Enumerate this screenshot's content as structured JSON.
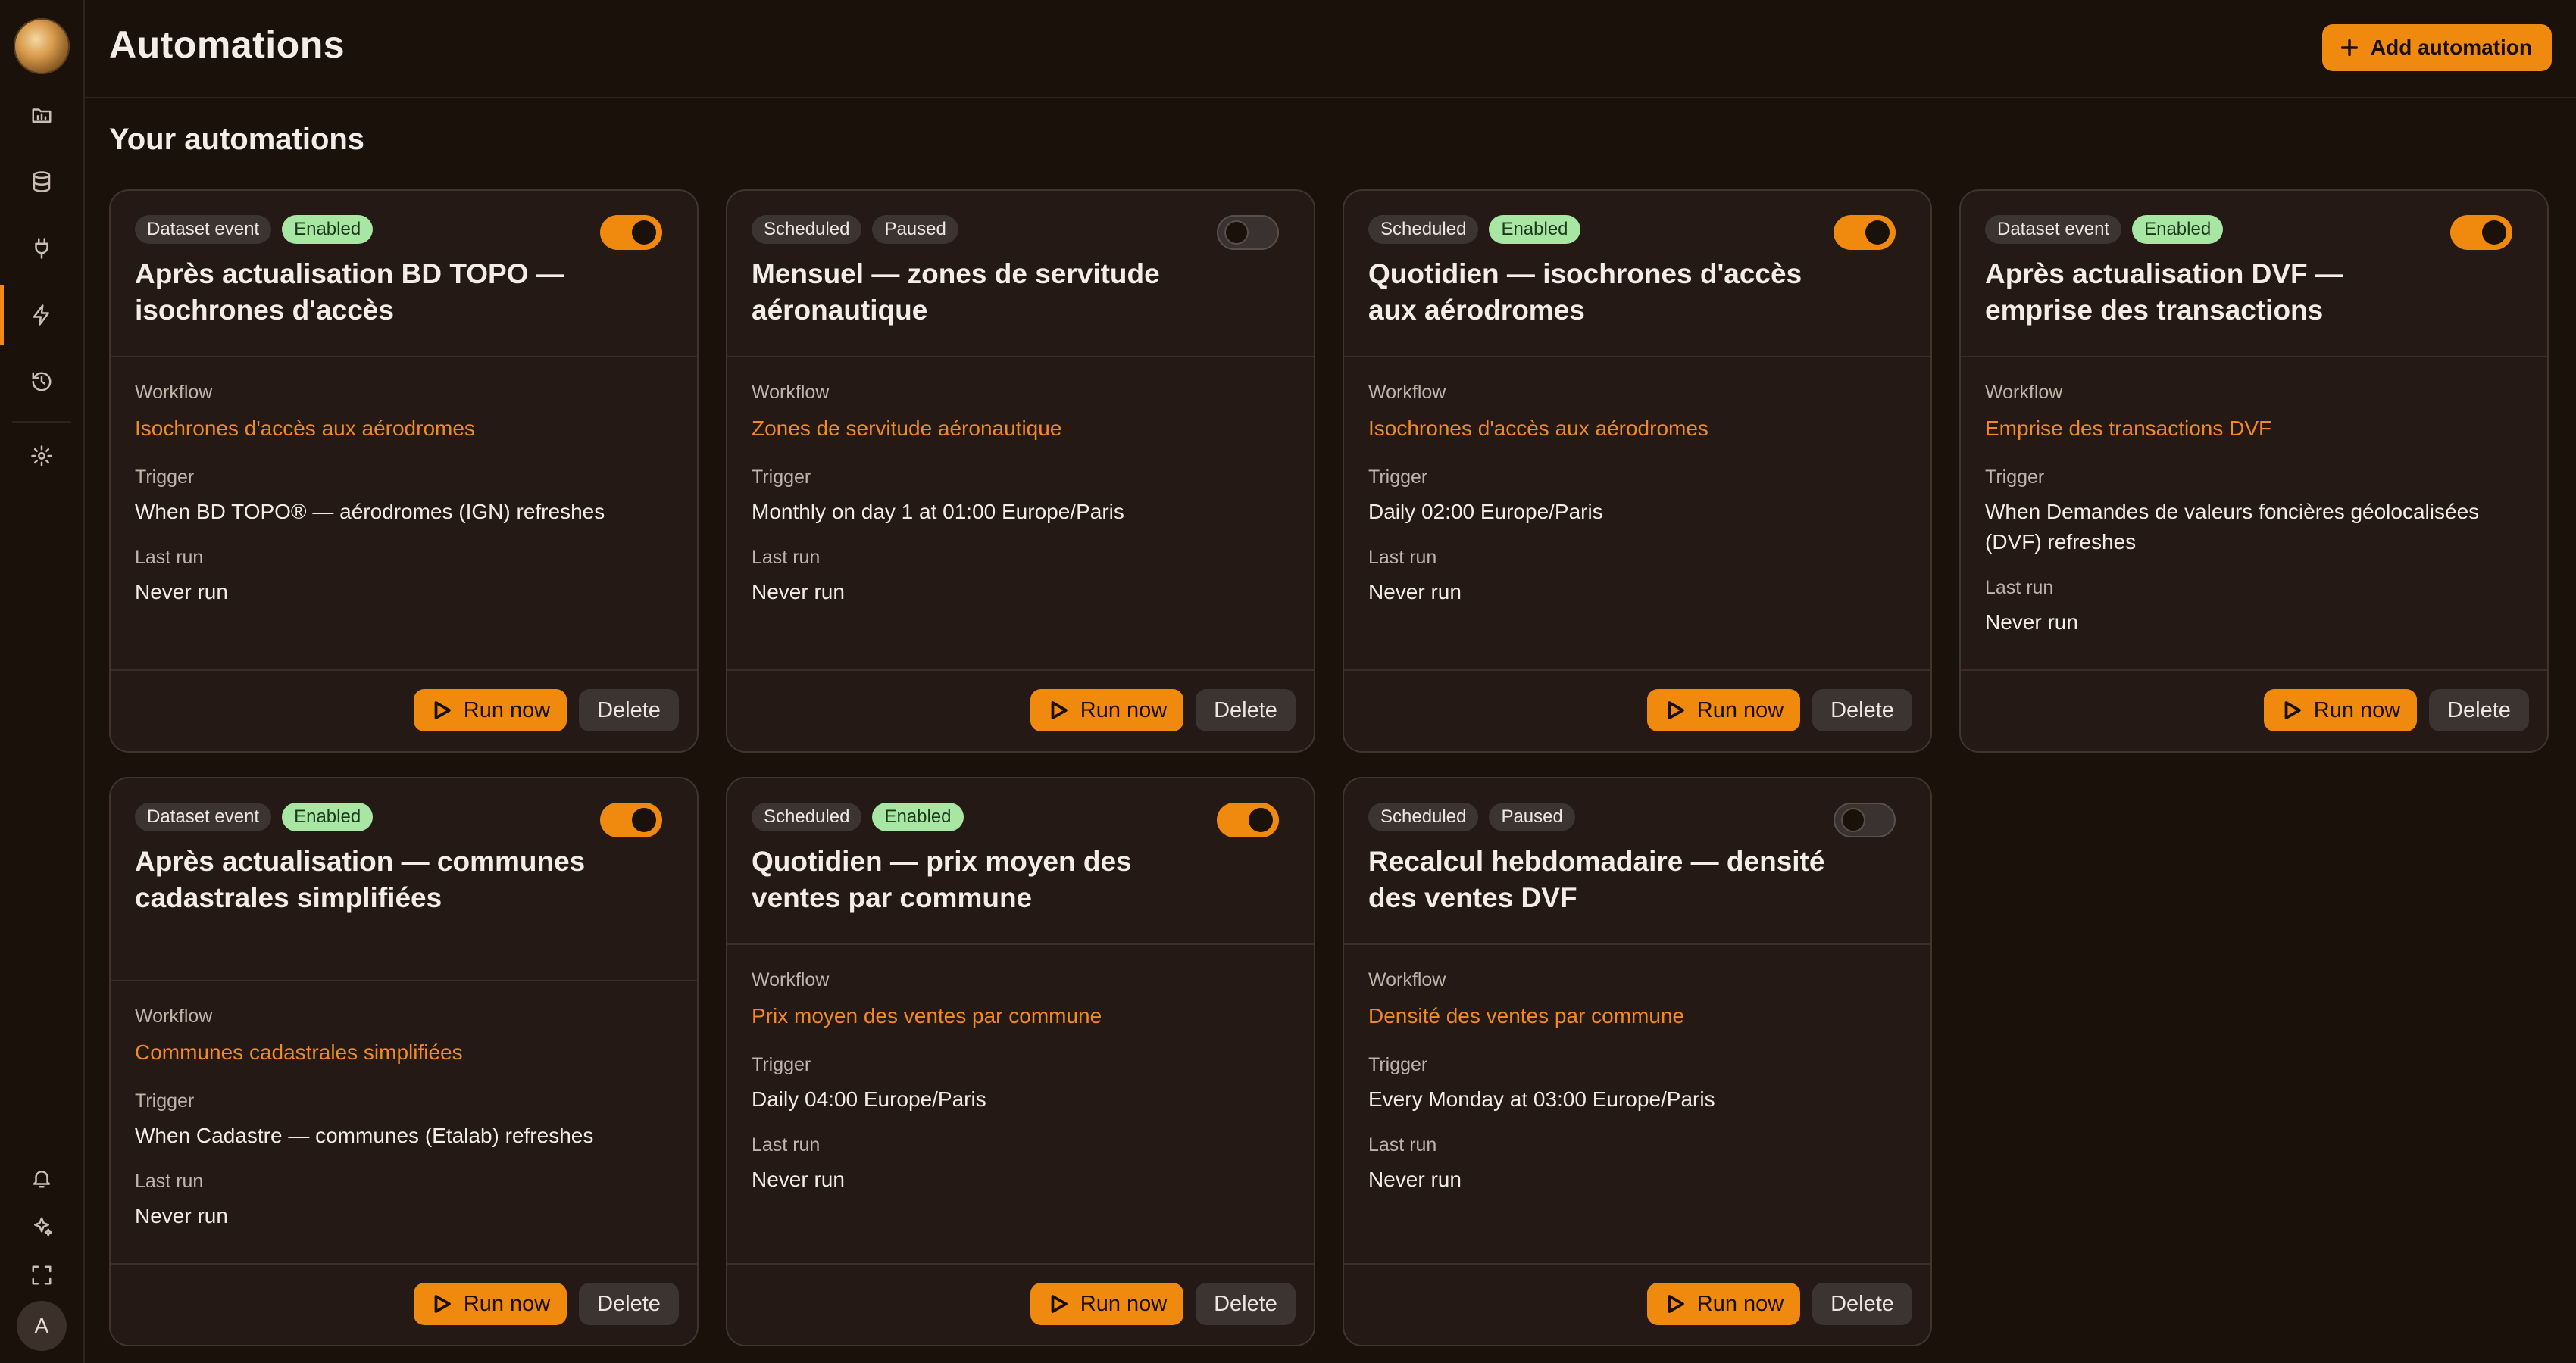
{
  "header": {
    "title": "Automations",
    "add_label": "Add automation"
  },
  "section_title": "Your automations",
  "sidebar": {
    "items": [
      "folder-chart-icon",
      "database-icon",
      "plug-icon",
      "lightning-icon",
      "history-icon",
      "settings-icon"
    ],
    "bottom": [
      "bell-icon",
      "sparkles-icon",
      "fullscreen-icon"
    ],
    "avatar_initial": "A"
  },
  "labels": {
    "workflow": "Workflow",
    "trigger": "Trigger",
    "last_run": "Last run",
    "run_now": "Run now",
    "delete": "Delete"
  },
  "cards": [
    {
      "type": "Dataset event",
      "status": "Enabled",
      "enabled": true,
      "title": "Après actualisation BD TOPO — isochrones d'accès",
      "workflow": "Isochrones d'accès aux aérodromes",
      "trigger": "When BD TOPO® — aérodromes (IGN) refreshes",
      "last_run": "Never run"
    },
    {
      "type": "Scheduled",
      "status": "Paused",
      "enabled": false,
      "title": "Mensuel — zones de servitude aéronautique",
      "workflow": "Zones de servitude aéronautique",
      "trigger": "Monthly on day 1 at 01:00 Europe/Paris",
      "last_run": "Never run"
    },
    {
      "type": "Scheduled",
      "status": "Enabled",
      "enabled": true,
      "title": "Quotidien — isochrones d'accès aux aérodromes",
      "workflow": "Isochrones d'accès aux aérodromes",
      "trigger": "Daily 02:00 Europe/Paris",
      "last_run": "Never run"
    },
    {
      "type": "Dataset event",
      "status": "Enabled",
      "enabled": true,
      "title": "Après actualisation DVF — emprise des transactions",
      "workflow": "Emprise des transactions DVF",
      "trigger": "When Demandes de valeurs foncières géolocalisées (DVF) refreshes",
      "last_run": "Never run"
    },
    {
      "type": "Dataset event",
      "status": "Enabled",
      "enabled": true,
      "title": "Après actualisation — communes cadastrales simplifiées",
      "workflow": "Communes cadastrales simplifiées",
      "trigger": "When Cadastre — communes (Etalab) refreshes",
      "last_run": "Never run"
    },
    {
      "type": "Scheduled",
      "status": "Enabled",
      "enabled": true,
      "title": "Quotidien — prix moyen des ventes par commune",
      "workflow": "Prix moyen des ventes par commune",
      "trigger": "Daily 04:00 Europe/Paris",
      "last_run": "Never run"
    },
    {
      "type": "Scheduled",
      "status": "Paused",
      "enabled": false,
      "title": "Recalcul hebdomadaire — densité des ventes DVF",
      "workflow": "Densité des ventes par commune",
      "trigger": "Every Monday at 03:00 Europe/Paris",
      "last_run": "Never run"
    }
  ]
}
